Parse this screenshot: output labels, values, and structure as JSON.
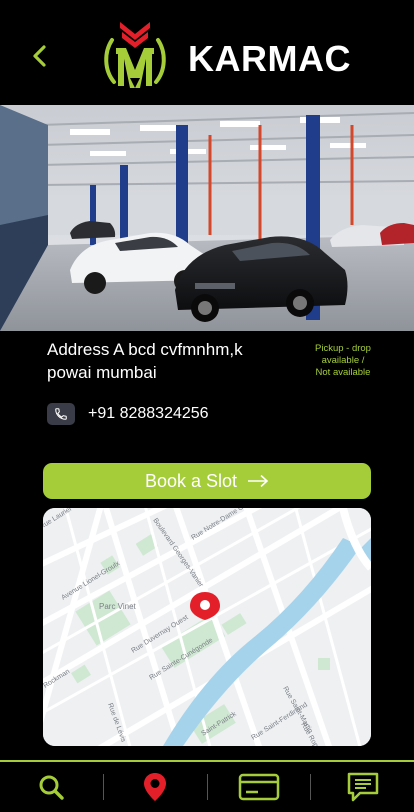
{
  "header": {
    "brand": "KARMAC",
    "back_icon": "chevron-left-icon",
    "logo": "karmac-logo"
  },
  "colors": {
    "accent": "#a5cd39",
    "logo_red": "#e3202a",
    "background": "#000000",
    "pin_red": "#e3202a",
    "phone_chip": "#3a3d47"
  },
  "details": {
    "address": "Address A bcd cvfmnhm,k powai mumbai",
    "pickup_line1": "Pickup - drop",
    "pickup_line2": "available /",
    "pickup_line3": "Not available",
    "phone_icon": "phone-icon",
    "phone": "+91 8288324256"
  },
  "booking": {
    "label": "Book a Slot",
    "arrow_icon": "arrow-right-icon"
  },
  "map": {
    "pin_icon": "location-pin-icon",
    "streets": [
      "Rue Notre-Dame Ouest",
      "Boulevard Georges-Vanier",
      "Avenue Lionel-Groulx",
      "Parc Vinet",
      "Rue Duvernay Ouest",
      "Rue Sainte-Cunégonde",
      "Rue de Lévis",
      "Saint-Patrick",
      "Rue Saint-Ferdinand",
      "Rue Laurier",
      "Rockman",
      "Rue Ropery",
      "Rue Saint-Martin"
    ]
  },
  "nav": {
    "items": [
      {
        "icon": "search-icon"
      },
      {
        "icon": "location-pin-icon"
      },
      {
        "icon": "card-icon"
      },
      {
        "icon": "chat-icon"
      }
    ]
  }
}
